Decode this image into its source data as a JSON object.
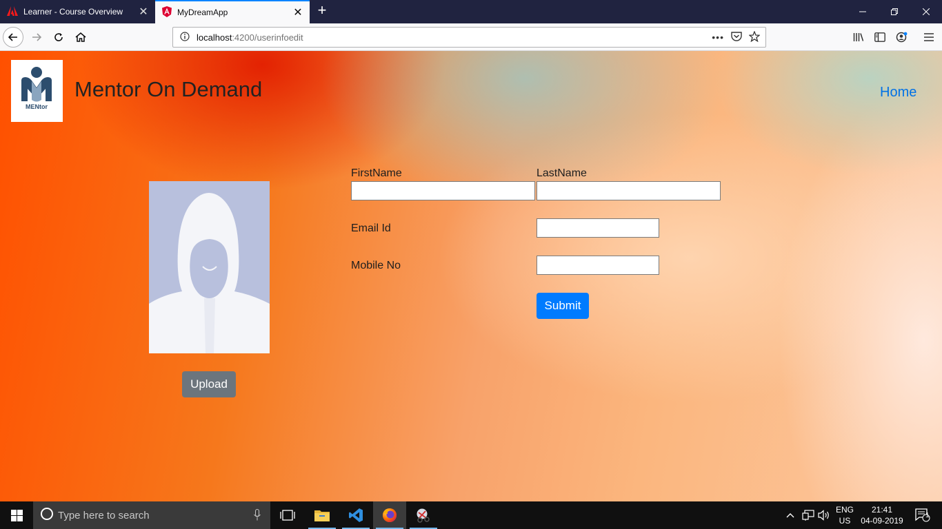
{
  "browser": {
    "tabs": [
      {
        "title": "Learner - Course Overview",
        "active": false
      },
      {
        "title": "MyDreamApp",
        "active": true
      }
    ],
    "url": {
      "host": "localhost",
      "rest": ":4200/userinfoedit"
    }
  },
  "header": {
    "logo_text": "MENtor",
    "brand": "Mentor On Demand",
    "nav_home": "Home"
  },
  "profile": {
    "upload_label": "Upload"
  },
  "form": {
    "first_name_label": "FirstName",
    "last_name_label": "LastName",
    "email_label": "Email Id",
    "mobile_label": "Mobile No",
    "first_name_value": "",
    "last_name_value": "",
    "email_value": "",
    "mobile_value": "",
    "submit_label": "Submit"
  },
  "taskbar": {
    "search_placeholder": "Type here to search",
    "lang_top": "ENG",
    "lang_bottom": "US",
    "time": "21:41",
    "date": "04-09-2019",
    "notifications": "1"
  },
  "colors": {
    "primary": "#007bff",
    "secondary": "#6c757d",
    "link": "#0071e6",
    "tab_bar": "#202340"
  }
}
